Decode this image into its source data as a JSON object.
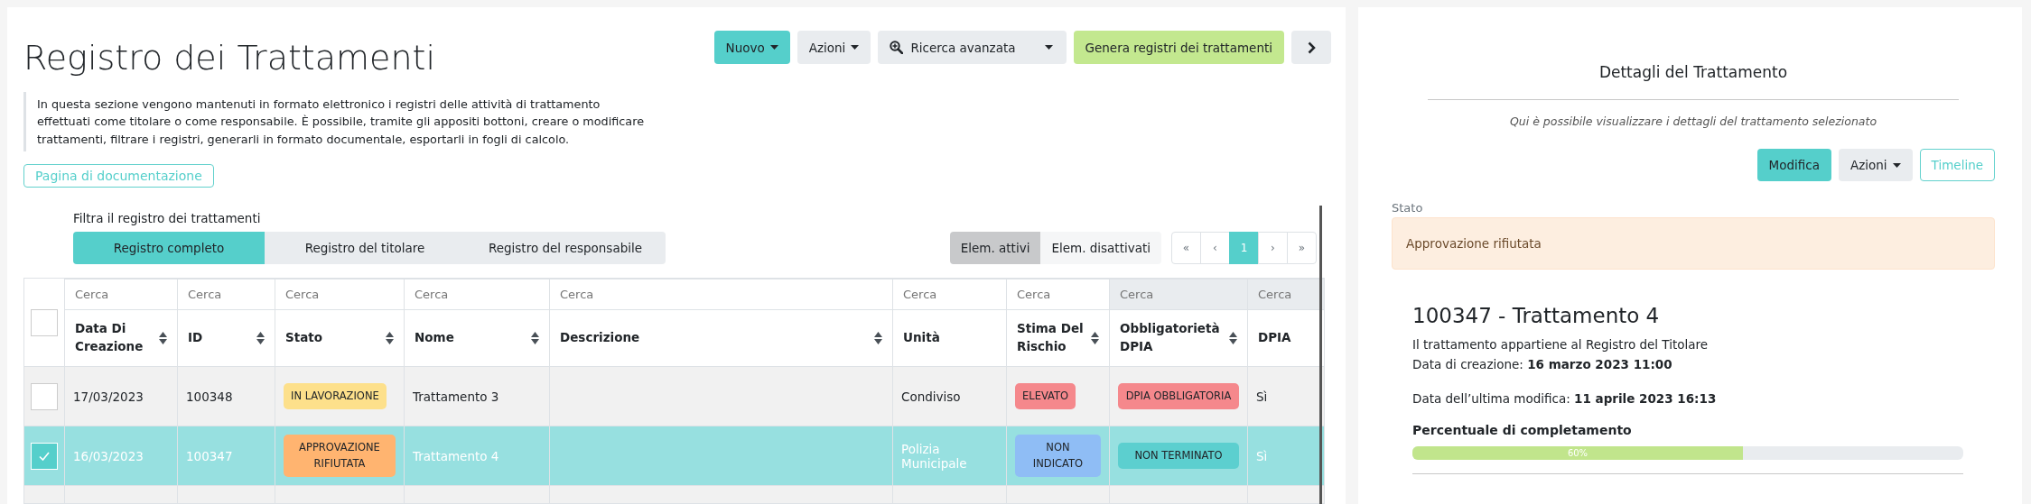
{
  "main": {
    "title": "Registro dei Trattamenti",
    "toolbar": [
      {
        "kind": "primary",
        "label": "Nuovo",
        "caret": true
      },
      {
        "kind": "secondary",
        "label": "Azioni",
        "caret": true
      },
      {
        "kind": "search",
        "label": "Ricerca avanzata",
        "caret": true
      },
      {
        "kind": "success",
        "label": "Genera registri dei trattamenti",
        "caret": false
      },
      {
        "kind": "next"
      }
    ],
    "description": "In questa sezione vengono mantenuti in formato elettronico i registri delle attività di trattamento effettuati come titolare o come responsabile. È possibile, tramite gli appositi bottoni, creare o modificare trattamenti, filtrare i registri, generarli in formato documentale, esportarli in fogli di calcolo.",
    "doc_button": "Pagina di documentazione",
    "filter_label": "Filtra il registro dei trattamenti",
    "filter_tabs": [
      {
        "label": "Registro completo",
        "selected": true
      },
      {
        "label": "Registro del titolare",
        "selected": false
      },
      {
        "label": "Registro del responsabile",
        "selected": false
      }
    ],
    "state_toggle": [
      {
        "label": "Elem. attivi",
        "selected": true
      },
      {
        "label": "Elem. disattivati",
        "selected": false
      }
    ],
    "pagination": [
      {
        "label": "«",
        "selected": false
      },
      {
        "label": "‹",
        "selected": false
      },
      {
        "label": "1",
        "selected": true
      },
      {
        "label": "›",
        "selected": false
      },
      {
        "label": "»",
        "selected": false
      }
    ],
    "table": {
      "select_all_checked": false,
      "columns": [
        {
          "label": "Data Di Creazione",
          "placeholder": "Cerca",
          "sortable": true,
          "disabled": false
        },
        {
          "label": "ID",
          "placeholder": "Cerca",
          "sortable": true,
          "disabled": false
        },
        {
          "label": "Stato",
          "placeholder": "Cerca",
          "sortable": true,
          "disabled": false
        },
        {
          "label": "Nome",
          "placeholder": "Cerca",
          "sortable": true,
          "disabled": false
        },
        {
          "label": "Descrizione",
          "placeholder": "Cerca",
          "sortable": true,
          "disabled": false
        },
        {
          "label": "Unità",
          "placeholder": "Cerca",
          "sortable": false,
          "disabled": false
        },
        {
          "label": "Stima Del Rischio",
          "placeholder": "Cerca",
          "sortable": true,
          "disabled": false
        },
        {
          "label": "Obbligatorietà DPIA",
          "placeholder": "Cerca",
          "sortable": true,
          "disabled": true
        },
        {
          "label": "DPIA",
          "placeholder": "Cerca",
          "sortable": false,
          "disabled": true
        }
      ],
      "rows": [
        {
          "selected": false,
          "checked": false,
          "cells": [
            {
              "kind": "text",
              "text": "17/03/2023"
            },
            {
              "kind": "text",
              "text": "100348"
            },
            {
              "kind": "badge",
              "text": "IN LAVORAZIONE",
              "color": "#fde08b"
            },
            {
              "kind": "text",
              "text": "Trattamento 3"
            },
            {
              "kind": "text",
              "text": ""
            },
            {
              "kind": "text",
              "text": "Condiviso"
            },
            {
              "kind": "badge",
              "text": "ELEVATO",
              "color": "#f5888c"
            },
            {
              "kind": "badge",
              "text": "DPIA OBBLIGATORIA",
              "color": "#f5888c"
            },
            {
              "kind": "text",
              "text": "Sì"
            }
          ]
        },
        {
          "selected": true,
          "checked": true,
          "cells": [
            {
              "kind": "text",
              "text": "16/03/2023"
            },
            {
              "kind": "text",
              "text": "100347"
            },
            {
              "kind": "badge",
              "text": "APPROVAZIONE RIFIUTATA",
              "color": "#ffb470"
            },
            {
              "kind": "text",
              "text": "Trattamento 4"
            },
            {
              "kind": "text",
              "text": ""
            },
            {
              "kind": "text",
              "text": "Polizia Municipale"
            },
            {
              "kind": "badge",
              "text": "NON INDICATO",
              "color": "#8fbdf5"
            },
            {
              "kind": "badge",
              "text": "NON TERMINATO",
              "color": "#5ccfcf"
            },
            {
              "kind": "text",
              "text": "Sì"
            }
          ]
        }
      ]
    }
  },
  "details": {
    "title": "Dettagli del Trattamento",
    "subtitle": "Qui è possibile visualizzare i dettagli del trattamento selezionato",
    "buttons": [
      {
        "kind": "primary",
        "label": "Modifica",
        "caret": false
      },
      {
        "kind": "secondary",
        "label": "Azioni",
        "caret": true
      },
      {
        "kind": "outline",
        "label": "Timeline",
        "caret": false
      }
    ],
    "status_label": "Stato",
    "status": "Approvazione rifiutata",
    "heading": "100347 - Trattamento 4",
    "register_line": "Il trattamento appartiene al Registro del Titolare",
    "created": "Data di creazione: **16 marzo 2023 11:00**",
    "modified": "Data dell’ultima modifica: **11 aprile 2023 16:13**",
    "progress_label": "Percentuale di completamento",
    "progress": {
      "level": 0.6,
      "reading": "60%"
    }
  }
}
